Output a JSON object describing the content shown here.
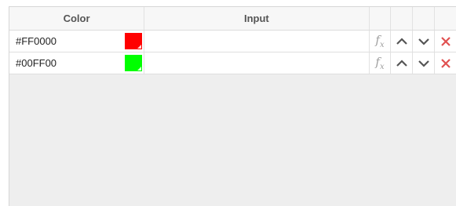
{
  "table": {
    "headers": {
      "color": "Color",
      "input": "Input"
    },
    "rows": [
      {
        "hex": "#FF0000",
        "swatch_color": "#FF0000",
        "input": ""
      },
      {
        "hex": "#00FF00",
        "swatch_color": "#00FF00",
        "input": ""
      }
    ]
  },
  "icons": {
    "formula": "fx-icon",
    "move_up": "chevron-up-icon",
    "move_down": "chevron-down-icon",
    "delete": "close-icon"
  },
  "colors": {
    "delete_icon": "#e05050",
    "arrow_icon": "#555555",
    "fx_icon": "#a0a0a0"
  }
}
